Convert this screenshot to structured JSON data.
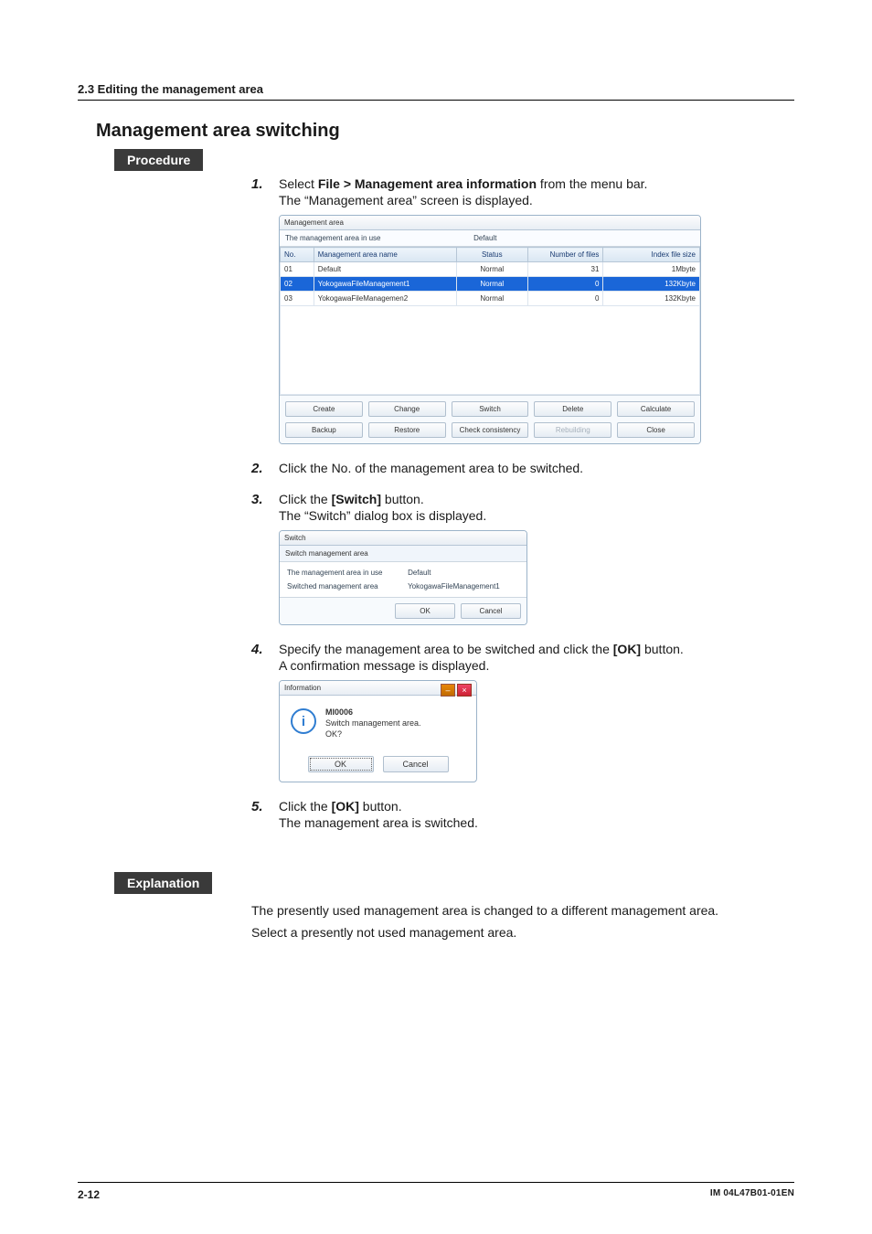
{
  "page": {
    "breadcrumb": "2.3  Editing the management area",
    "title": "Management area switching",
    "procedure_label": "Procedure",
    "explanation_label": "Explanation"
  },
  "steps": {
    "s1": {
      "num": "1.",
      "main_pre": "Select ",
      "main_bold": "File > Management area information",
      "main_post": " from the menu bar.",
      "sub": "The “Management area” screen is displayed."
    },
    "s2": {
      "num": "2.",
      "main": "Click the No. of the management area to be switched."
    },
    "s3": {
      "num": "3.",
      "main_pre": "Click the ",
      "main_bold": "[Switch]",
      "main_post": " button.",
      "sub": "The “Switch” dialog box is displayed."
    },
    "s4": {
      "num": "4.",
      "main_pre": "Specify the management area to be switched and click the ",
      "main_bold": "[OK]",
      "main_post": " button.",
      "sub": "A confirmation message is displayed."
    },
    "s5": {
      "num": "5.",
      "main_pre": "Click the ",
      "main_bold": "[OK]",
      "main_post": " button.",
      "sub": "The management area is switched."
    }
  },
  "mgmt_window": {
    "title": "Management area",
    "in_use_label": "The management area in use",
    "in_use_value": "Default",
    "cols": {
      "no": "No.",
      "name": "Management area name",
      "status": "Status",
      "files": "Number of files",
      "index": "Index file size"
    },
    "rows": [
      {
        "no": "01",
        "name": "Default",
        "status": "Normal",
        "files": "31",
        "index": "1Mbyte",
        "sel": false
      },
      {
        "no": "02",
        "name": "YokogawaFileManagement1",
        "status": "Normal",
        "files": "0",
        "index": "132Kbyte",
        "sel": true
      },
      {
        "no": "03",
        "name": "YokogawaFileManagemen2",
        "status": "Normal",
        "files": "0",
        "index": "132Kbyte",
        "sel": false
      }
    ],
    "buttons": {
      "create": "Create",
      "change": "Change",
      "switch": "Switch",
      "delete": "Delete",
      "calculate": "Calculate",
      "backup": "Backup",
      "restore": "Restore",
      "check": "Check consistency",
      "rebuild": "Rebuilding",
      "close": "Close"
    }
  },
  "switch_dialog": {
    "title": "Switch",
    "header": "Switch  management area",
    "row1_label": "The management area in use",
    "row1_value": "Default",
    "row2_label": "Switched management area",
    "row2_value": "YokogawaFileManagement1",
    "ok": "OK",
    "cancel": "Cancel"
  },
  "info_dialog": {
    "title": "Information",
    "code": "MI0006",
    "msg": "Switch management area. OK?",
    "ok": "OK",
    "cancel": "Cancel"
  },
  "explanation": {
    "p1": "The presently used management area is changed to a different management area.",
    "p2": "Select a presently not used management area."
  },
  "footer": {
    "left": "2-12",
    "right": "IM 04L47B01-01EN"
  }
}
